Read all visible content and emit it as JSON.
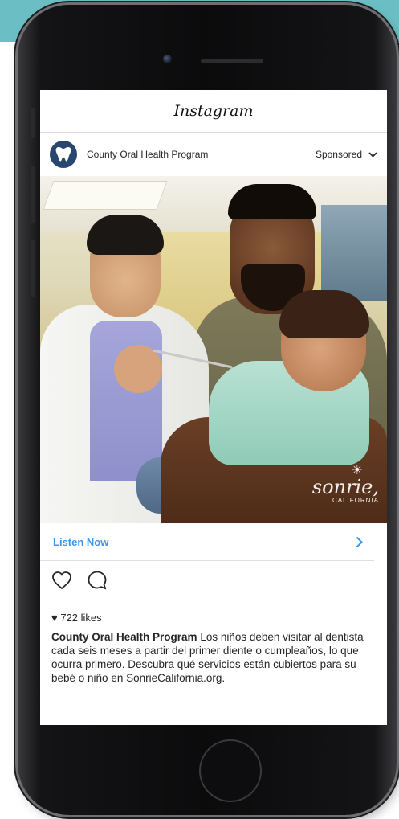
{
  "app": {
    "title": "Instagram"
  },
  "post": {
    "account_name": "County Oral Health Program",
    "sponsored_label": "Sponsored",
    "photo_watermark": {
      "word": "sonrie,",
      "sub": "CALIFORNIA"
    },
    "cta_label": "Listen Now",
    "likes_count": "722 likes",
    "caption_author": "County Oral Health Program",
    "caption_text": "Los niños deben visitar al dentista cada seis meses a partir del primer diente o cumpleaños, lo que ocurra primero. Descubra qué servicios están cubiertos para su bebé o niño en SonrieCalifornia.org."
  },
  "icons": {
    "avatar": "tooth-icon",
    "sponsored_menu": "chevron-down-icon",
    "cta_arrow": "chevron-right-icon",
    "like": "heart-icon",
    "comment": "comment-bubble-icon",
    "likes_prefix": "small-heart-icon"
  },
  "colors": {
    "accent_link": "#3897f0",
    "avatar_bg": "#27476e",
    "background_band": "#6bbfc4"
  }
}
